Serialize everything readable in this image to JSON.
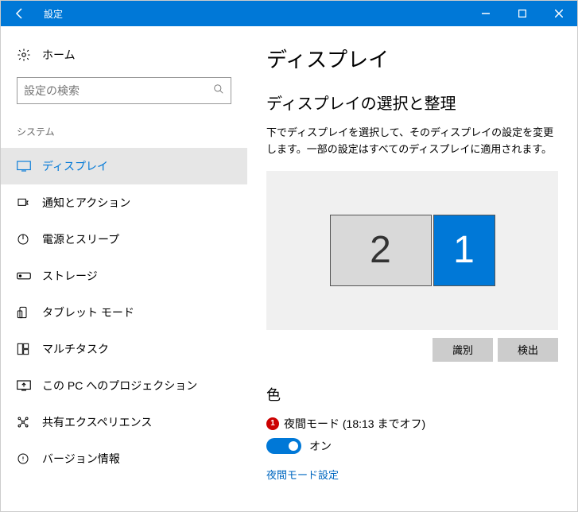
{
  "window": {
    "title": "設定"
  },
  "sidebar": {
    "home_label": "ホーム",
    "search_placeholder": "設定の検索",
    "category_label": "システム",
    "items": [
      {
        "label": "ディスプレイ",
        "active": true
      },
      {
        "label": "通知とアクション",
        "active": false
      },
      {
        "label": "電源とスリープ",
        "active": false
      },
      {
        "label": "ストレージ",
        "active": false
      },
      {
        "label": "タブレット モード",
        "active": false
      },
      {
        "label": "マルチタスク",
        "active": false
      },
      {
        "label": "この PC へのプロジェクション",
        "active": false
      },
      {
        "label": "共有エクスペリエンス",
        "active": false
      },
      {
        "label": "バージョン情報",
        "active": false
      }
    ]
  },
  "main": {
    "page_title": "ディスプレイ",
    "arrange_heading": "ディスプレイの選択と整理",
    "arrange_desc": "下でディスプレイを選択して、そのディスプレイの設定を変更します。一部の設定はすべてのディスプレイに適用されます。",
    "monitors": [
      {
        "num": "2",
        "primary": false
      },
      {
        "num": "1",
        "primary": true
      }
    ],
    "identify_btn": "識別",
    "detect_btn": "検出",
    "color_heading": "色",
    "badge_num": "1",
    "night_mode_label": "夜間モード (18:13 までオフ)",
    "toggle_state_label": "オン",
    "night_mode_link": "夜間モード設定"
  }
}
